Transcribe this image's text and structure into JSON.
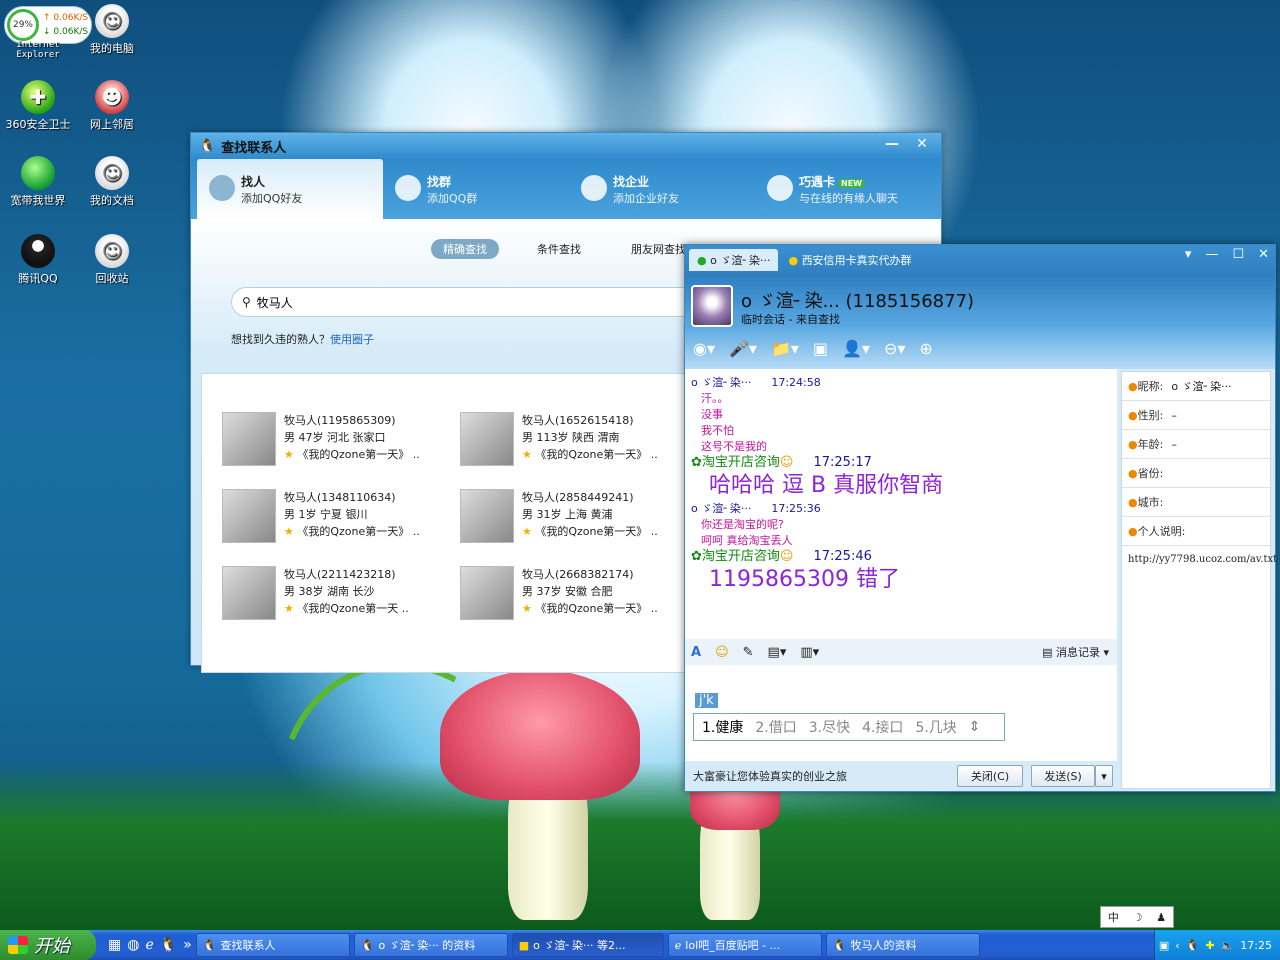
{
  "netspeed": {
    "percent": "29%",
    "up": "0.06K/S",
    "down": "0.06K/S"
  },
  "desktop_icons": [
    {
      "label": "Internet Explorer",
      "icon": "ie-icon"
    },
    {
      "label": "我的电脑",
      "icon": "computer-icon"
    },
    {
      "label": "360安全卫士",
      "icon": "360-icon"
    },
    {
      "label": "网上邻居",
      "icon": "network-icon"
    },
    {
      "label": "宽带我世界",
      "icon": "globe-icon"
    },
    {
      "label": "我的文档",
      "icon": "documents-icon"
    },
    {
      "label": "腾讯QQ",
      "icon": "qq-icon"
    },
    {
      "label": "回收站",
      "icon": "recycle-bin-icon"
    }
  ],
  "find_window": {
    "title": "查找联系人",
    "tabs": [
      {
        "title": "找人",
        "subtitle": "添加QQ好友"
      },
      {
        "title": "找群",
        "subtitle": "添加QQ群"
      },
      {
        "title": "找企业",
        "subtitle": "添加企业好友"
      },
      {
        "title": "巧遇卡",
        "subtitle": "与在线的有缘人聊天",
        "badge": "NEW"
      }
    ],
    "subtabs": [
      "精确查找",
      "条件查找",
      "朋友网查找"
    ],
    "search_value": "牧马人",
    "hint_text": "想找到久违的熟人？",
    "hint_link": "使用圈子",
    "results": [
      {
        "name": "牧马人(1195865309)",
        "detail": "男 47岁 河北 张家口",
        "blog": "《我的Qzone第一天》",
        "more": ".."
      },
      {
        "name": "牧马人(1652615418)",
        "detail": "男 113岁 陕西 渭南",
        "blog": "《我的Qzone第一天》",
        "more": ".."
      },
      {
        "name": "牧马人(1348110634)",
        "detail": "男 1岁 宁夏 银川",
        "blog": "《我的Qzone第一天》",
        "more": ".."
      },
      {
        "name": "牧马人(2858449241)",
        "detail": "男 31岁 上海 黄浦",
        "blog": "《我的Qzone第一天》",
        "more": ".."
      },
      {
        "name": "牧马人(2211423218)",
        "detail": "男 38岁 湖南 长沙",
        "blog": "《我的Qzone第一天",
        "more": ".."
      },
      {
        "name": "牧马人(2668382174)",
        "detail": "男 37岁 安徽 合肥",
        "blog": "《我的Qzone第一天》",
        "more": ".."
      }
    ]
  },
  "chat_window": {
    "tabs": [
      "o ゞ渲╴染···",
      "西安信用卡真实代办群"
    ],
    "contact_name": "o ゞ渲╴染...",
    "contact_qq": "(1185156877)",
    "contact_sub": "临时会话 - 来自查找",
    "messages": [
      {
        "sender": "o ゞ渲╴染···",
        "time": "17:24:58",
        "lines": [
          "汗。。",
          "没事",
          "我不怕",
          "这号不是我的"
        ],
        "big": ""
      },
      {
        "sender": "淘宝开店咨询",
        "time": "17:25:17",
        "lines": [],
        "big": "哈哈哈  逗  B  真服你智商"
      },
      {
        "sender": "o ゞ渲╴染···",
        "time": "17:25:36",
        "lines": [
          "你还是淘宝的呢?",
          "呵呵  真给淘宝丢人"
        ],
        "big": ""
      },
      {
        "sender": "淘宝开店咨询",
        "time": "17:25:46",
        "lines": [],
        "big": "1195865309    错了"
      }
    ],
    "history_label": "消息记录",
    "ime_composition": "j'k",
    "ime_candidates": [
      "1.健康",
      "2.借口",
      "3.尽快",
      "4.接口",
      "5.几块"
    ],
    "ad_text": "大富豪让您体验真实的创业之旅",
    "close_label": "关闭(C)",
    "send_label": "发送(S)",
    "profile": [
      {
        "key": "昵称:",
        "value": "o ゞ渲╴染···"
      },
      {
        "key": "性别:",
        "value": "–"
      },
      {
        "key": "年龄:",
        "value": "–"
      },
      {
        "key": "省份:",
        "value": ""
      },
      {
        "key": "城市:",
        "value": ""
      },
      {
        "key": "个人说明:",
        "value": ""
      }
    ],
    "profile_note": "http://yy7798.ucoz.com/av.txt"
  },
  "ime_bar": "中",
  "taskbar": {
    "start_label": "开始",
    "tasks": [
      "查找联系人",
      "o ゞ渲╴染···  的资料",
      "o ゞ渲╴染···  等2...",
      "lol吧_百度贴吧 - ...",
      "牧马人的资料"
    ],
    "clock": "17:25"
  },
  "colors": {
    "taskbar": "#245fd2",
    "start": "#2e8d2e",
    "accent": "#2f8acd"
  }
}
